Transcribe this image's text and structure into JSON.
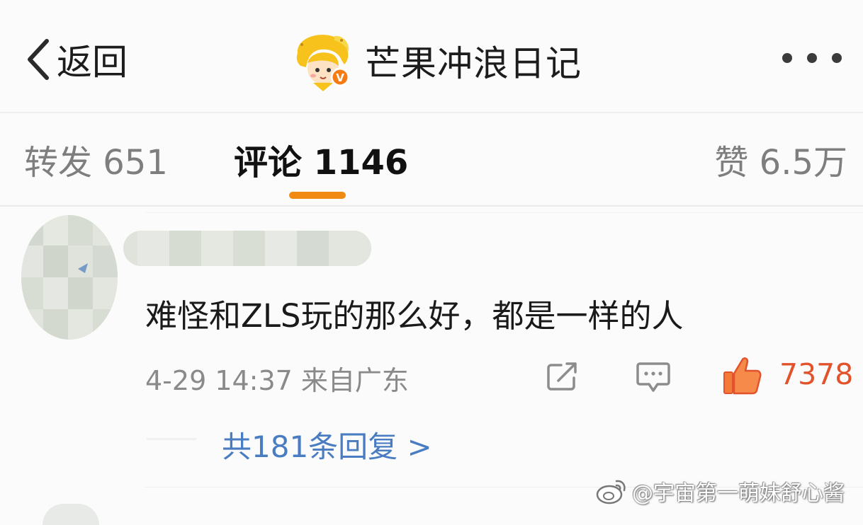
{
  "header": {
    "back_label": "返回",
    "account_name": "芒果冲浪日记",
    "verified_badge": "V",
    "more_icon": "more-dots-icon"
  },
  "tabs": [
    {
      "label": "转发 651",
      "active": false
    },
    {
      "label": "评论 1146",
      "active": true
    },
    {
      "label": "赞 6.5万",
      "active": false
    }
  ],
  "colors": {
    "accent": "#f08a12",
    "like": "#e2532c",
    "link": "#4a7cc2"
  },
  "comment": {
    "text": "难怪和ZLS玩的那么好，都是一样的人",
    "meta": "4-29 14:37 来自广东",
    "like_count": "7378",
    "replies_link": "共181条回复 >",
    "icons": [
      "share-icon",
      "comment-icon",
      "like-icon"
    ]
  },
  "watermark": {
    "text": "@宇宙第一萌妹舒心酱"
  }
}
